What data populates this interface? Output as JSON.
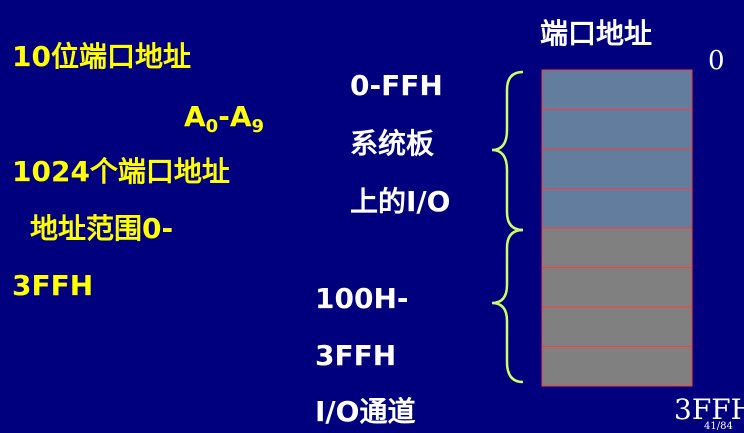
{
  "left_text": {
    "line1": "10位端口地址",
    "address_range": {
      "a": "A",
      "a_sub": "0",
      "dash": "-",
      "b": "A",
      "b_sub": "9"
    },
    "line3": "1024个端口地址",
    "line4": "地址范围0-",
    "line5": "3FFH"
  },
  "diagram": {
    "title": "端口地址",
    "top_label": "0",
    "bottom_label": "3FFH",
    "system_group": {
      "lines": [
        "0-FFH",
        "系统板",
        "上的I/O"
      ],
      "color": "#627d9d",
      "block_count": 4
    },
    "channel_group": {
      "lines": [
        "100H-",
        "3FFH",
        "I/O通道"
      ],
      "color": "#808080",
      "block_count": 4
    },
    "block_border_color": "#ff3b3b",
    "brace_color": "#ccff66"
  },
  "slide_number": "41/84"
}
